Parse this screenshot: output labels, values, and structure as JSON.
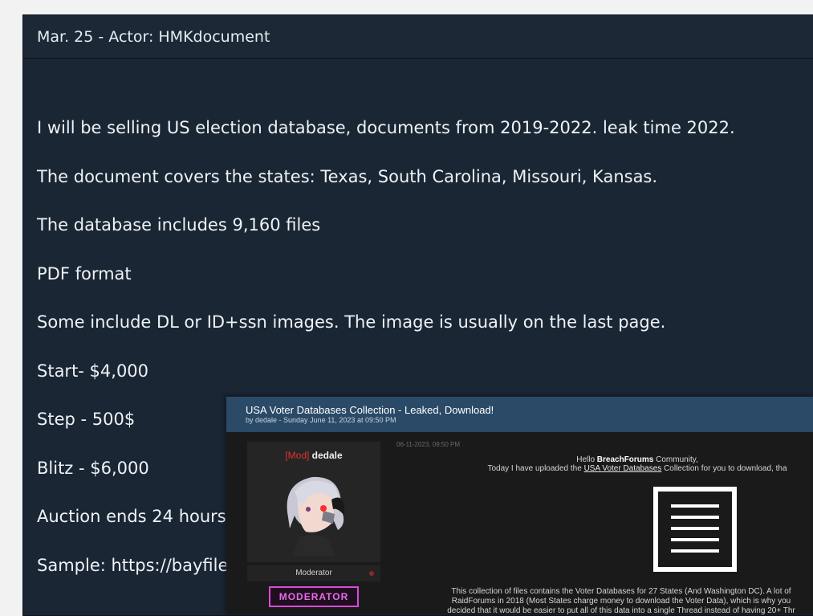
{
  "post": {
    "header": "Mar. 25 - Actor: HMKdocument",
    "lines": [
      "I will be selling US election database, documents from 2019-2022. leak time 2022.",
      "The document covers the states: Texas, South Carolina, Missouri, Kansas.",
      "The database includes 9,160 files",
      "PDF format",
      "Some include DL or ID+ssn images. The image is usually on the last page.",
      "Start- $4,000",
      "Step - 500$",
      "Blitz - $6,000",
      "Auction ends 24 hours",
      "Sample: https://bayfile"
    ]
  },
  "forum": {
    "title": "USA Voter Databases Collection - Leaked, Download!",
    "byline": "by dedale - Sunday June 11, 2023 at 09:50 PM",
    "date": "06-11-2023, 09:50 PM",
    "user": {
      "tag": "[Mod]",
      "name": "dedale",
      "role": "Moderator",
      "badge": "MODERATOR"
    },
    "greeting_pre": "Hello ",
    "greeting_bold": "BreachForums",
    "greeting_post": " Community,",
    "upload_pre": "Today I have uploaded the ",
    "upload_link": "USA Voter Databases",
    "upload_post": " Collection for you to download, tha",
    "desc_lines": [
      "This collection of files contains the Voter Databases for 27 States (And Washington DC). A lot of",
      "RaidForums in 2018 (Most States charge money to download the Voter Data), which is why you",
      "decided that it would be easier to put all of this data into a single Thread instead of having 20+ Thr"
    ]
  },
  "colors": {
    "post_bg": "#1b2634",
    "inset_title_bar": "#2a4a68",
    "mod_tag": "#e53030",
    "mod_badge": "#d94ad9"
  },
  "icons": [
    "avatar-image",
    "document-icon",
    "online-status-dot"
  ]
}
